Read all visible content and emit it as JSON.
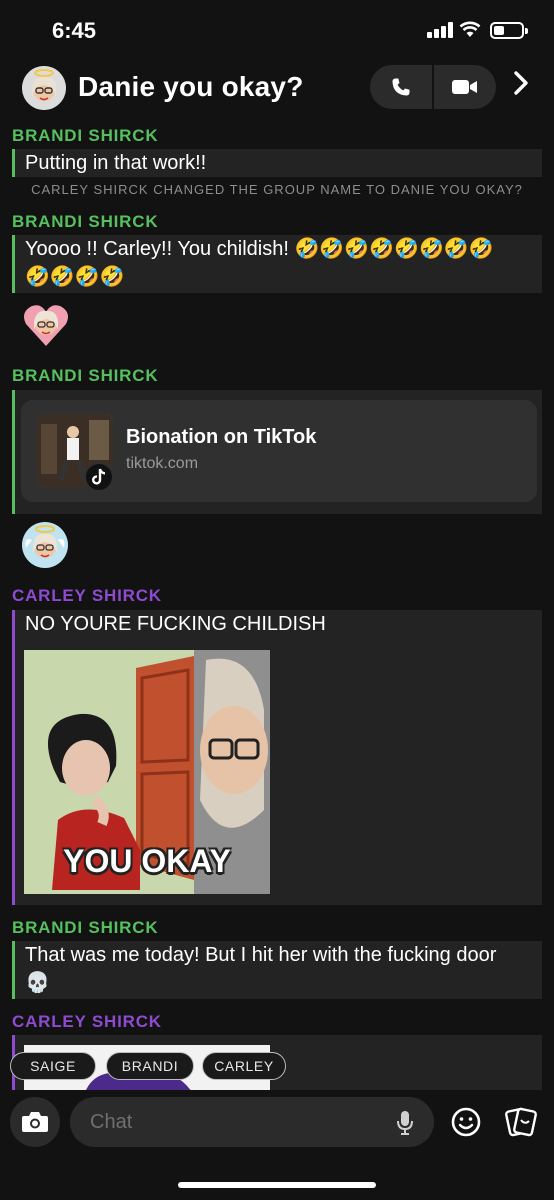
{
  "status_bar": {
    "time": "6:45"
  },
  "header": {
    "title": "Danie you okay?"
  },
  "messages": [
    {
      "sender": "BRANDI SHIRCK",
      "text": "Putting in that work!!"
    },
    {
      "system": "CARLEY SHIRCK CHANGED THE GROUP NAME TO DANIE YOU OKAY?"
    },
    {
      "sender": "BRANDI SHIRCK",
      "text_line1": "Yoooo !! Carley!! You childish! 🤣🤣🤣🤣🤣🤣🤣🤣",
      "text_line2": "🤣🤣🤣🤣"
    },
    {
      "sender": "BRANDI SHIRCK",
      "link_title": "Bionation on TikTok",
      "link_url": "tiktok.com"
    },
    {
      "sender": "CARLEY SHIRCK",
      "text": "NO YOURE FUCKING CHILDISH",
      "gif_caption": "YOU OKAY"
    },
    {
      "sender": "BRANDI SHIRCK",
      "text_line1": "That was me today! But I hit her with the fucking door",
      "text_line2": "💀"
    },
    {
      "sender": "CARLEY SHIRCK"
    }
  ],
  "mention_tags": [
    "SAIGE",
    "BRANDI",
    "CARLEY"
  ],
  "composer": {
    "placeholder": "Chat"
  },
  "colors": {
    "brandi": "#56c05e",
    "carley": "#8e4bcf",
    "background": "#121212"
  },
  "icons": [
    "phone-icon",
    "video-icon",
    "chevron-right-icon",
    "camera-icon",
    "mic-icon",
    "emoji-icon",
    "sticker-icon"
  ]
}
